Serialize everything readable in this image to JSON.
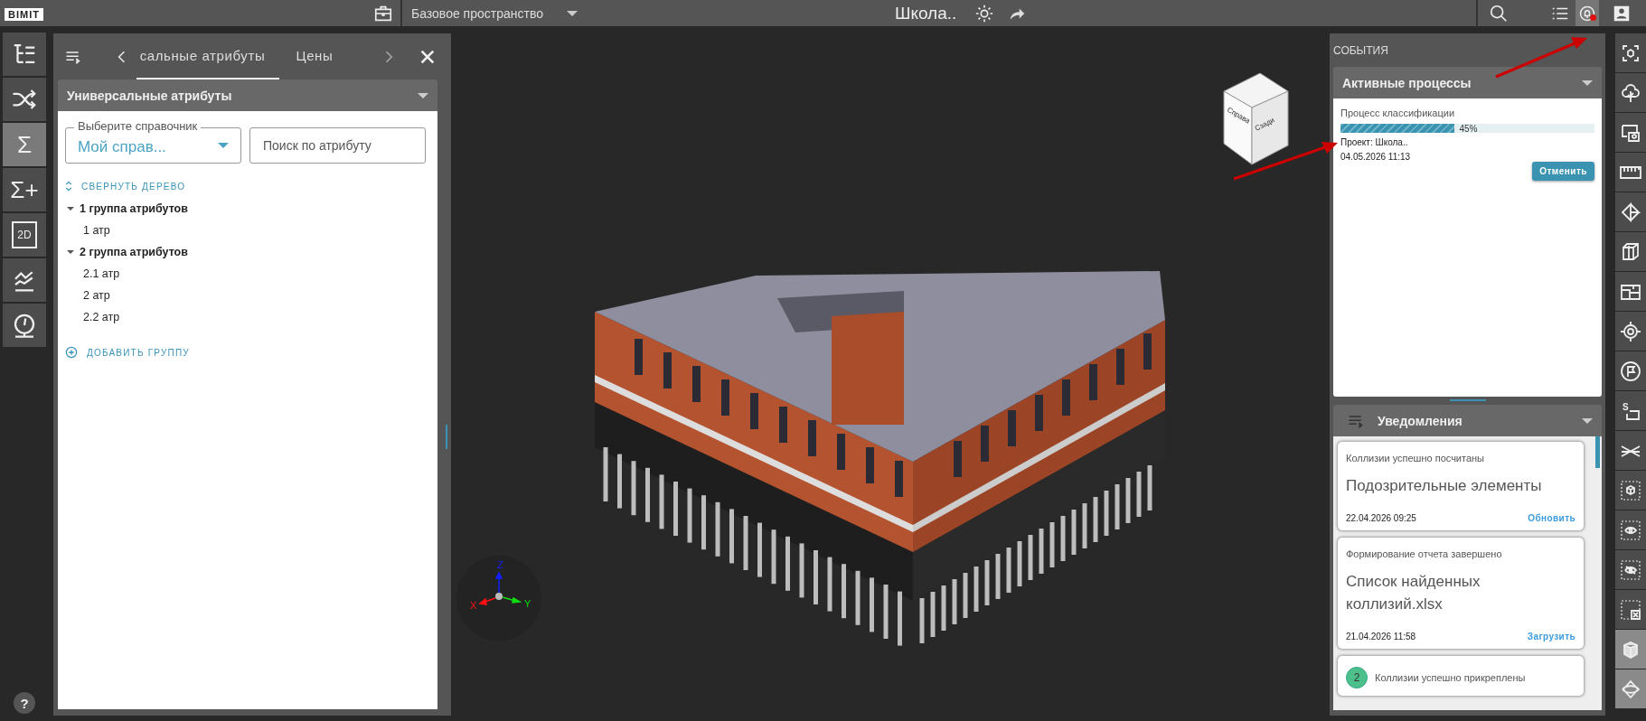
{
  "top_bar": {
    "logo": "BIMIT",
    "workspace": "Базовое пространство",
    "project_title": "Школа..",
    "notifications_button": {
      "selected": true,
      "alert": true
    }
  },
  "left_toolbar": {
    "items": [
      {
        "kind": "tree",
        "selected": false
      },
      {
        "kind": "shuffle",
        "selected": false
      },
      {
        "kind": "glyph",
        "glyph": "Σ",
        "selected": true
      },
      {
        "kind": "glyph",
        "glyph": "Σ+",
        "selected": false
      },
      {
        "kind": "sheet",
        "glyph": "2D",
        "selected": false
      },
      {
        "kind": "chart",
        "selected": false
      },
      {
        "kind": "gauge",
        "selected": false
      }
    ],
    "help": "?"
  },
  "attributes_panel": {
    "tabs": [
      {
        "label": "сальные атрибуты",
        "selected": true
      },
      {
        "label": "Цены",
        "selected": false
      }
    ],
    "section_title": "Универсальные атрибуты",
    "dictionary_select": {
      "label": "Выберите справочник",
      "value": "Мой справ..."
    },
    "search": {
      "placeholder": "Поиск по атрибуту"
    },
    "collapse_link": "СВЕРНУТЬ ДЕРЕВО",
    "tree": [
      {
        "label": "1 группа атрибутов",
        "expanded": true,
        "children": [
          {
            "label": "1 атр"
          }
        ]
      },
      {
        "label": "2 группа атрибутов",
        "expanded": true,
        "children": [
          {
            "label": "2.1 атр"
          },
          {
            "label": "2 атр"
          },
          {
            "label": "2.2 атр"
          }
        ]
      }
    ],
    "add_group": "ДОБАВИТЬ ГРУППУ"
  },
  "viewport": {
    "view_cube": {
      "left_face": "Справа",
      "right_face": "Сзади"
    },
    "axes": {
      "x": "X",
      "y": "Y",
      "z": "Z"
    }
  },
  "events_panel": {
    "title": "СОБЫТИЯ",
    "active_processes": {
      "title": "Активные процессы",
      "process": {
        "name": "Процесс классификации",
        "level": 0.45,
        "percent": "45%",
        "project": "Проект: Школа..",
        "date": "04.05.2026 11:13",
        "cancel": "Отменить"
      }
    },
    "notifications": {
      "title": "Уведомления",
      "items": [
        {
          "kind": "action",
          "heading": "Коллизии успешно посчитаны",
          "body": "Подозрительные элементы",
          "date": "22.04.2026 09:25",
          "action": "Обновить"
        },
        {
          "kind": "action",
          "heading": "Формирование отчета завершено",
          "body": "Список найденных коллизий.xlsx",
          "date": "21.04.2026 11:58",
          "action": "Загрузить"
        },
        {
          "kind": "count",
          "count": "2",
          "heading": "Коллизии успешно прикреплены"
        }
      ]
    }
  },
  "right_toolbar": {
    "items": [
      {
        "kind": "focus",
        "selected": false
      },
      {
        "kind": "cloud-tree",
        "selected": false
      },
      {
        "kind": "screen-focus",
        "selected": false
      },
      {
        "kind": "ruler",
        "selected": false
      },
      {
        "kind": "plane",
        "selected": false
      },
      {
        "kind": "section-box",
        "selected": false
      },
      {
        "kind": "floor-plan",
        "selected": false
      },
      {
        "kind": "target",
        "selected": false
      },
      {
        "kind": "flag",
        "selected": false
      },
      {
        "kind": "select",
        "glyph": "S",
        "selected": false
      },
      {
        "kind": "levels",
        "selected": false
      },
      {
        "kind": "cube-dashed",
        "selected": false
      },
      {
        "kind": "eye-dashed",
        "selected": false
      },
      {
        "kind": "eye-off-dashed",
        "selected": false
      },
      {
        "kind": "clear-dashed",
        "selected": false
      },
      {
        "kind": "cube",
        "selected": true
      },
      {
        "kind": "orbit",
        "selected": true
      }
    ]
  }
}
